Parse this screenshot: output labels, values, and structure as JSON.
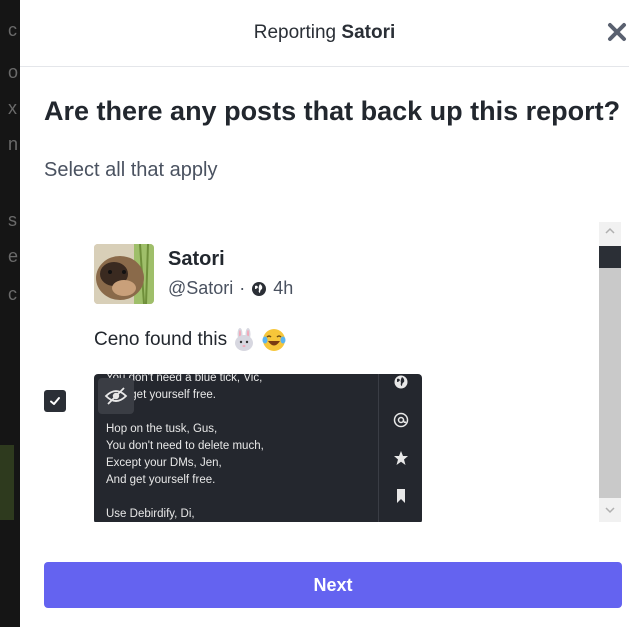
{
  "header": {
    "prefix": "Reporting",
    "name": "Satori",
    "close_icon": "close-icon"
  },
  "question": "Are there any posts that back up this report?",
  "subtitle": "Select all that apply",
  "post": {
    "checked": true,
    "author": "Satori",
    "handle": "@Satori",
    "separator": "·",
    "time": "4h",
    "text": "Ceno found this",
    "embed_lines": [
      "You don't need a blue tick, Vic,",
      "Just get yourself free.",
      "",
      "Hop on the tusk, Gus,",
      "You don't need to delete much,",
      "Except your DMs, Jen,",
      "And get yourself free.",
      "",
      "Use Debirdify, Di,"
    ]
  },
  "next_label": "Next",
  "colors": {
    "accent": "#6463f0",
    "dark": "#24272e"
  }
}
